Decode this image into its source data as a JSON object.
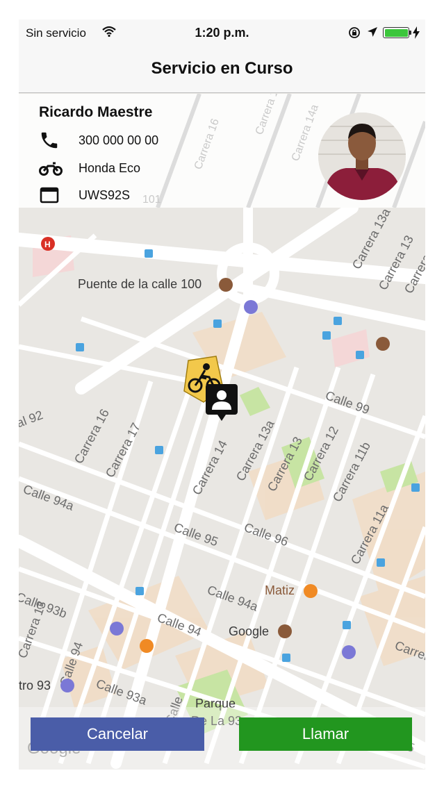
{
  "status_bar": {
    "carrier": "Sin servicio",
    "time": "1:20 p.m.",
    "battery_level": 1.0,
    "battery_color": "#3cc63c"
  },
  "nav": {
    "title": "Servicio en Curso"
  },
  "driver": {
    "name": "Ricardo Maestre",
    "phone": "300 000 00 00",
    "vehicle": "Honda Eco",
    "plate": "UWS92S",
    "icons": {
      "phone": "phone-icon",
      "vehicle": "motorcycle-icon",
      "plate": "license-plate-icon"
    }
  },
  "map": {
    "streets": [
      "Carrera 13a",
      "Carrera 13",
      "Carrera 15",
      "Carrera 16",
      "Carrera 17",
      "Carrera 14",
      "Carrera 13a",
      "Carrera 13",
      "Carrera 12",
      "Carrera 11b",
      "Carrera 11a",
      "Calle 99",
      "Calle 94a",
      "Calle 95",
      "Calle 96",
      "Calle 94a",
      "Calle 94",
      "Calle 93a",
      "Calle 93b",
      "Carrera 16",
      "Carrera 15",
      "Carrera 13",
      "Calle 94",
      "Calle",
      "nal 92"
    ],
    "places": {
      "bridge": "Puente de la calle 100",
      "restaurant": "Matiz",
      "company": "Google",
      "park": "Parque",
      "park2": "De La 93",
      "district": "tro 93"
    },
    "header_map_labels": [
      "Carrera 16",
      "Carrera 14a",
      "Carrera 13a",
      "101"
    ],
    "attribution": "Google"
  },
  "actions": {
    "cancel": "Cancelar",
    "call": "Llamar",
    "cancel_color": "#4a5da8",
    "call_color": "#22961f"
  }
}
